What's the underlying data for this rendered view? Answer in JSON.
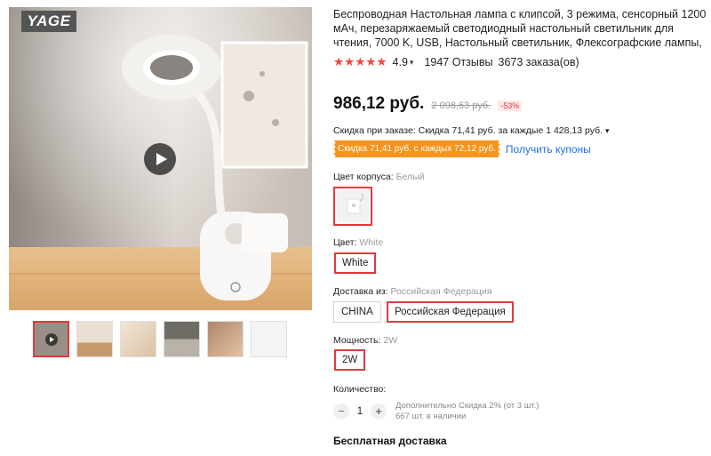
{
  "gallery": {
    "brand": "YAGE",
    "thumbnails": [
      {
        "name": "video-thumb",
        "color": "#9a8f86",
        "active": true
      },
      {
        "name": "thumb-2",
        "color": "#e9dfd2",
        "active": false
      },
      {
        "name": "thumb-3",
        "color": "#d9c2a4",
        "active": false
      },
      {
        "name": "thumb-4",
        "color": "#8a8780",
        "active": false
      },
      {
        "name": "thumb-5",
        "color": "#c8a48a",
        "active": false
      },
      {
        "name": "thumb-6",
        "color": "#f2f2f2",
        "active": false
      }
    ]
  },
  "product": {
    "title": "Беспроводная Настольная лампа с клипсой, 3 режима, сенсорный 1200 мАч, перезаряжаемый светодиодный настольный светильник для чтения, 7000 K, USB, Настольный светильник, Флексографские лампы, настольные",
    "stars": "★★★★★",
    "rating": "4.9",
    "reviews": "1947 Отзывы",
    "orders": "3673 заказа(ов)",
    "price": "986,12 руб.",
    "old_price": "2 098,63 руб.",
    "discount": "-53%",
    "order_discount": "Скидка при заказе: Скидка 71,41 руб. за каждые 1 428,13 руб.",
    "coupon_tag": "Скидка 71,41 руб. с каждых 72,12 руб.",
    "coupon_link": "Получить купоны"
  },
  "options": {
    "body_color_label": "Цвет корпуса:",
    "body_color_value": "Белый",
    "color_label": "Цвет:",
    "color_value": "White",
    "color_option": "White",
    "ship_from_label": "Доставка из:",
    "ship_from_value": "Российская Федерация",
    "ship_from_options": [
      "CHINA",
      "Российская Федерация"
    ],
    "power_label": "Мощность:",
    "power_value": "2W",
    "power_option": "2W"
  },
  "quantity": {
    "label": "Количество:",
    "minus": "−",
    "value": "1",
    "plus": "+",
    "extra_discount": "Дополнительно Скидка 2% (от 3 шт.)",
    "in_stock": "667 шт. в наличии"
  },
  "shipping": {
    "title": "Бесплатная доставка"
  },
  "colors": {
    "accent": "#e03a3a",
    "coupon": "#f7941d",
    "link": "#1a73e8"
  }
}
